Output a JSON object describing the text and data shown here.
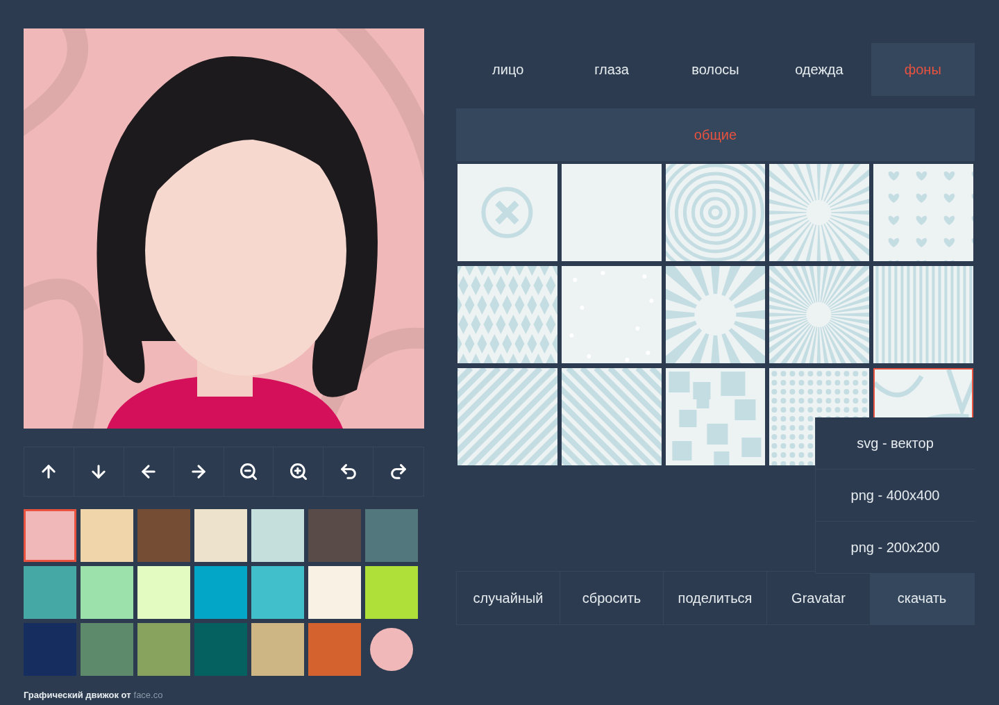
{
  "tabs": [
    {
      "label": "лицо",
      "selected": false
    },
    {
      "label": "глаза",
      "selected": false
    },
    {
      "label": "волосы",
      "selected": false
    },
    {
      "label": "одежда",
      "selected": false
    },
    {
      "label": "фоны",
      "selected": true
    }
  ],
  "category": {
    "label": "общие"
  },
  "backgrounds": [
    {
      "kind": "none",
      "selected": false
    },
    {
      "kind": "plain",
      "selected": false
    },
    {
      "kind": "rings",
      "selected": false
    },
    {
      "kind": "rays",
      "selected": false
    },
    {
      "kind": "hearts",
      "selected": false
    },
    {
      "kind": "diamonds",
      "selected": false
    },
    {
      "kind": "stars",
      "selected": false
    },
    {
      "kind": "wide-rays",
      "selected": false
    },
    {
      "kind": "burst",
      "selected": false
    },
    {
      "kind": "stripes",
      "selected": false
    },
    {
      "kind": "diagonal-up",
      "selected": false
    },
    {
      "kind": "diagonal-down",
      "selected": false
    },
    {
      "kind": "squares",
      "selected": false
    },
    {
      "kind": "dots",
      "selected": false
    },
    {
      "kind": "arcs",
      "selected": true
    }
  ],
  "download_menu": {
    "items": [
      "svg - вектор",
      "png - 400x400",
      "png - 200x200"
    ]
  },
  "actions": [
    {
      "label": "случайный",
      "selected": false
    },
    {
      "label": "сбросить",
      "selected": false
    },
    {
      "label": "поделиться",
      "selected": false
    },
    {
      "label": "Gravatar",
      "selected": false
    },
    {
      "label": "скачать",
      "selected": true
    }
  ],
  "tools": [
    {
      "kind": "up"
    },
    {
      "kind": "down"
    },
    {
      "kind": "left"
    },
    {
      "kind": "right"
    },
    {
      "kind": "zoom-out"
    },
    {
      "kind": "zoom-in"
    },
    {
      "kind": "undo"
    },
    {
      "kind": "redo"
    }
  ],
  "swatches": [
    {
      "kind": "square",
      "color": "#f0b8b8",
      "selected": true
    },
    {
      "kind": "square",
      "color": "#f0d5ab",
      "selected": false
    },
    {
      "kind": "square",
      "color": "#754d35",
      "selected": false
    },
    {
      "kind": "square",
      "color": "#ede2cb",
      "selected": false
    },
    {
      "kind": "square",
      "color": "#c5e0dc",
      "selected": false
    },
    {
      "kind": "square",
      "color": "#584b48",
      "selected": false
    },
    {
      "kind": "square",
      "color": "#52777d",
      "selected": false
    },
    {
      "kind": "square",
      "color": "#45a8a5",
      "selected": false
    },
    {
      "kind": "square",
      "color": "#9ce0ab",
      "selected": false
    },
    {
      "kind": "square",
      "color": "#e3fbc0",
      "selected": false
    },
    {
      "kind": "square",
      "color": "#04a6c8",
      "selected": false
    },
    {
      "kind": "square",
      "color": "#41c0cc",
      "selected": false
    },
    {
      "kind": "square",
      "color": "#faf1e5",
      "selected": false
    },
    {
      "kind": "square",
      "color": "#afe03a",
      "selected": false
    },
    {
      "kind": "square",
      "color": "#162e5f",
      "selected": false
    },
    {
      "kind": "square",
      "color": "#5d8a6a",
      "selected": false
    },
    {
      "kind": "square",
      "color": "#88a35e",
      "selected": false
    },
    {
      "kind": "square",
      "color": "#05615f",
      "selected": false
    },
    {
      "kind": "square",
      "color": "#cdb584",
      "selected": false
    },
    {
      "kind": "square",
      "color": "#d3622e",
      "selected": false
    },
    {
      "kind": "circle",
      "color": "#f0b8b8"
    }
  ],
  "footer": {
    "text": "Графический движок от",
    "link": "face.co"
  }
}
